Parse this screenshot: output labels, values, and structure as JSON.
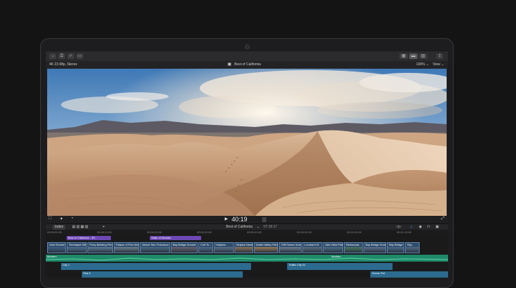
{
  "toolbar": {
    "import_icon": "down-arrow-icon",
    "keyword_icon": "key-icon",
    "check_icon": "check-icon",
    "share_icon": "share-icon"
  },
  "viewer": {
    "format_info": "4K 23.98p, Stereo",
    "project_title": "Best of California",
    "zoom": "100%",
    "view_label": "View"
  },
  "playback": {
    "timecode": "40:19"
  },
  "timeline_header": {
    "index_label": "Index",
    "project_name": "Best of California",
    "duration": "07:18:17"
  },
  "ruler_ticks": [
    "00:00:00:00",
    "00:00:10:00",
    "00:00:20:00",
    "00:00:30:00",
    "00:00:40:00",
    "00:00:50:00",
    "00:01:00:00",
    "00:01:10:00",
    "00:01:20:00"
  ],
  "titles": [
    {
      "label": "Best of California - 3D"
    },
    {
      "label": "State of Wonder"
    }
  ],
  "clips": [
    {
      "label": "Gold Sunset"
    },
    {
      "label": "Timelapse With"
    },
    {
      "label": "Ferry Building Pier 1"
    },
    {
      "label": "Palace of Fine Arts"
    },
    {
      "label": "Above San Francisco"
    },
    {
      "label": "Bay Bridge Sunset"
    },
    {
      "label": "Coit To..."
    },
    {
      "label": "Hollywo..."
    },
    {
      "label": "Mojave Desert"
    },
    {
      "label": "Death Valley Park"
    },
    {
      "label": "Cliff Ocean Sunset"
    },
    {
      "label": "Lombard St"
    },
    {
      "label": "Alta Vista Park"
    },
    {
      "label": "Redwoods"
    },
    {
      "label": "Bay Bridge Sunset VFX"
    },
    {
      "label": "Bay Bridge"
    },
    {
      "label": "Sky..."
    }
  ],
  "audio": {
    "track1": "Modern",
    "track2": "Modern",
    "track3": "City 1",
    "track4": "Traffic City 01",
    "track5": "Sea 3",
    "track6": "Ocean Set"
  }
}
